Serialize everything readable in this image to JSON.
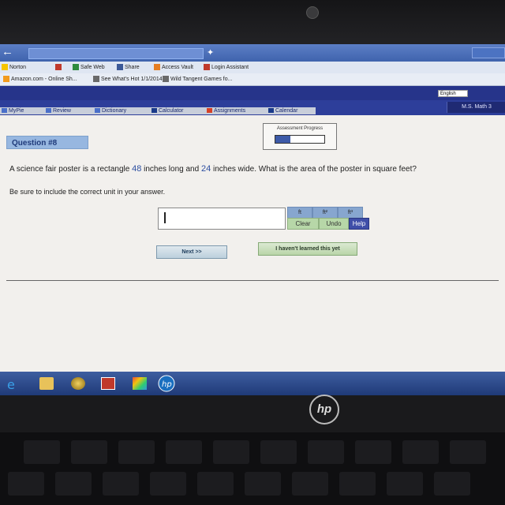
{
  "browser": {
    "back_icon": "back-arrow-icon",
    "bookmarks": [
      "Norton",
      "Safe Web",
      "Share",
      "Access Vault",
      "Login Assistant"
    ],
    "favorites": [
      "Amazon.com - Online Sh...",
      "See What's Hot 1/1/2014",
      "Wild Tangent Games fo..."
    ]
  },
  "header": {
    "language": "English",
    "course": "M.S. Math 3"
  },
  "nav": {
    "tabs": [
      "MyPie",
      "Review",
      "Dictionary",
      "Calculator",
      "Assignments",
      "Calendar"
    ]
  },
  "question": {
    "label": "Question #8",
    "text_before": "A science fair poster is a rectangle ",
    "length": "48",
    "text_middle": " inches long and ",
    "width": "24",
    "text_after": " inches wide. What is the area of the poster in square feet?",
    "instruction": "Be sure to include the correct unit in your answer."
  },
  "progress": {
    "title": "Assessment Progress",
    "fraction": 0.3
  },
  "answer": {
    "value": ""
  },
  "unit_buttons": [
    "ft",
    "ft²",
    "ft³"
  ],
  "actions": {
    "clear": "Clear",
    "undo": "Undo",
    "help": "Help",
    "next": "Next >>",
    "not_learned": "I haven't learned this yet"
  },
  "laptop": {
    "logo": "hp"
  },
  "colors": {
    "header_blue": "#2d3e9a",
    "question_label_bg": "#97b7e0",
    "unit_button_bg": "#87a6cf",
    "action_button_bg": "#b7d7a8",
    "help_button_bg": "#3f4ea8",
    "taskbar": "#2b4a8c"
  }
}
